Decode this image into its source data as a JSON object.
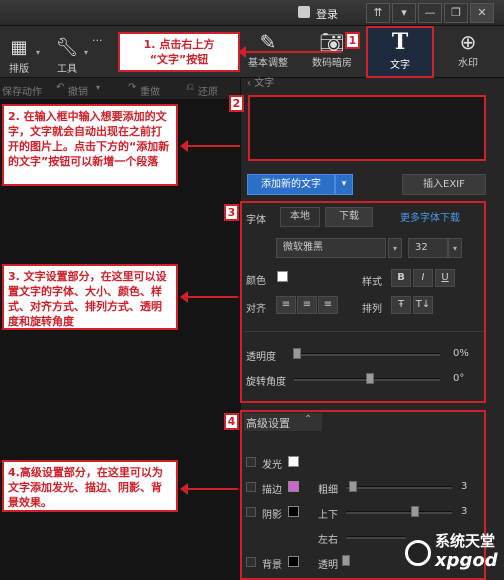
{
  "titlebar": {
    "login": "登录",
    "buttons": [
      "⇈",
      "▼",
      "—",
      "❐",
      "✕"
    ]
  },
  "toolbar": {
    "layout": "排版",
    "tools": "工具",
    "more": "···",
    "tabs": [
      {
        "label": "基本调整",
        "icon": "edit-icon"
      },
      {
        "label": "数码暗房",
        "icon": "camera-icon"
      },
      {
        "label": "文字",
        "icon": "text-icon"
      },
      {
        "label": "水印",
        "icon": "watermark-icon"
      }
    ]
  },
  "subbar": {
    "save": "保存动作",
    "undo": "撤销",
    "redo": "重做",
    "restore": "还原"
  },
  "annotations": {
    "a1": "1. 点击右上方\n“文字”按钮",
    "a2": "2. 在输入框中输入想要添加的文字，文字就会自动出现在之前打开的图片上。点击下方的“添加新的文字”按钮可以新增一个段落",
    "a3": "3. 文字设置部分，在这里可以设置文字的字体、大小、颜色、样式、对齐方式、排列方式、透明度和旋转角度",
    "a4": "4.高级设置部分，在这里可以为文字添加发光、描边、阴影、背景效果。",
    "n1": "1",
    "n2": "2",
    "n3": "3",
    "n4": "4"
  },
  "text_panel": {
    "section_title": "文字",
    "add_button": "添加新的文字",
    "insert_exif": "插入EXIF"
  },
  "font_settings": {
    "font_label": "字体",
    "tab_local": "本地",
    "tab_download": "下载",
    "more_fonts": "更多字体下载",
    "font_name": "微软雅黑",
    "font_size": "32",
    "color_label": "颜色",
    "style_label": "样式",
    "style_buttons": [
      "B",
      "I",
      "U"
    ],
    "align_label": "对齐",
    "arrange_label": "排列",
    "opacity_label": "透明度",
    "opacity_value": "0%",
    "opacity_level": 0,
    "rotation_label": "旋转角度",
    "rotation_value": "0°",
    "rotation_level": 0.5
  },
  "advanced": {
    "title": "高级设置",
    "glow": "发光",
    "stroke": "描边",
    "thickness": "粗细",
    "thickness_value": "3",
    "shadow": "阴影",
    "updown": "上下",
    "updown_value": "3",
    "leftright": "左右",
    "background": "背景",
    "opacity": "透明",
    "stroke_color": "#cc66cc"
  },
  "watermark": {
    "brand": "系统天堂",
    "site": "xpgod"
  }
}
